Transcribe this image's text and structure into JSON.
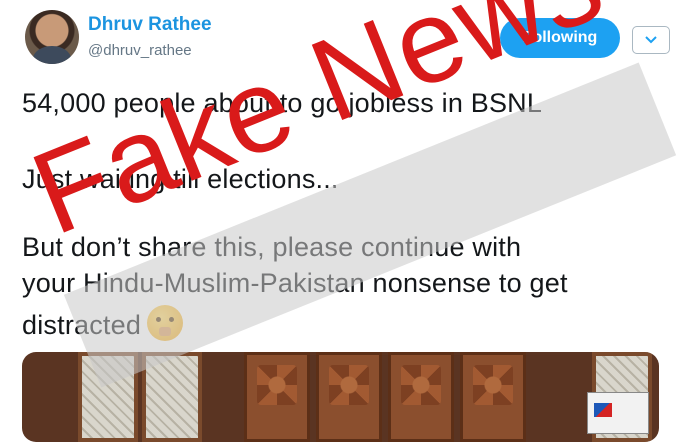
{
  "tweet": {
    "author_name": "Dhruv Rathee",
    "author_handle": "@dhruv_rathee",
    "follow_label": "Following",
    "lines": [
      "54,000 people about to go jobless in BSNL",
      "Just waiting till elections...",
      "But don’t share this, please continue with",
      "your Hindu-Muslim-Pakistan nonsense to get",
      "distracted"
    ],
    "emoji": "shushing-face"
  },
  "overlay": {
    "stamp_text": "Fake News",
    "stamp_color": "#d91a1a"
  },
  "colors": {
    "accent": "#1da1f2",
    "name": "#1c94e0",
    "handle": "#657786"
  }
}
